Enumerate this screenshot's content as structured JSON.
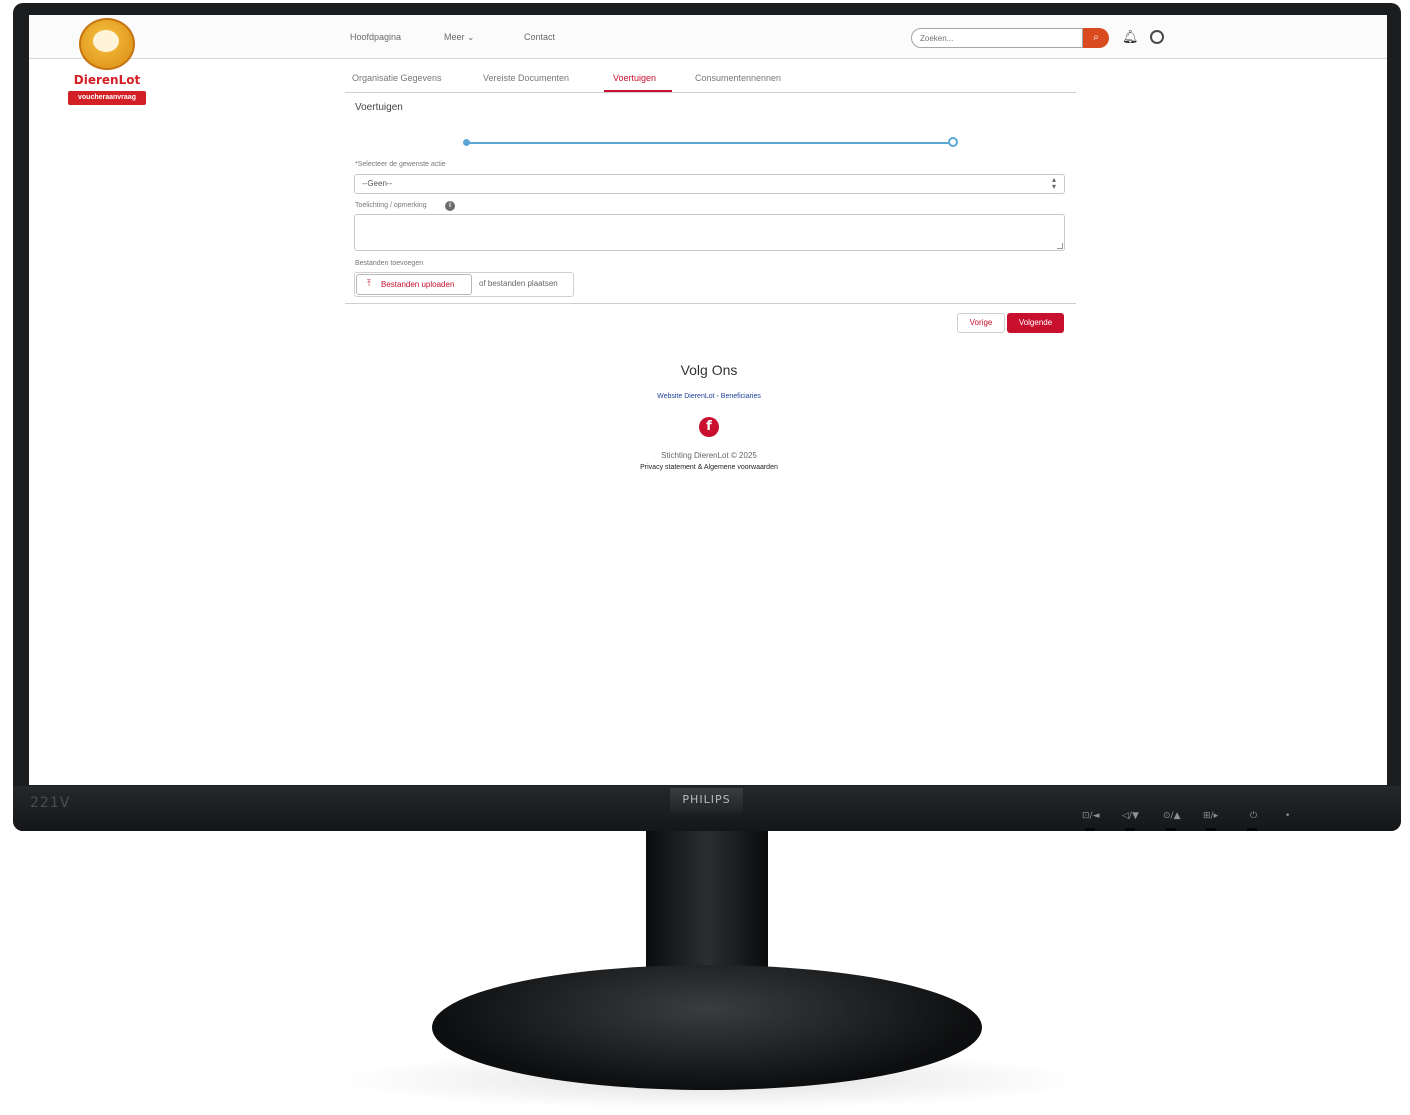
{
  "brand": {
    "logo_name": "DierenLot",
    "logo_tag": "voucheraanvraag",
    "monitor_model": "221V",
    "monitor_brand": "PHILIPS",
    "accent_color": "#c8102e"
  },
  "monitor_controls": [
    "⊡/◄",
    "◁/▼",
    "⊙/▲",
    "⊞/▸",
    "⏻",
    "•"
  ],
  "nav": {
    "items": [
      {
        "label": "Hoofdpagina"
      },
      {
        "label": "Meer ⌄"
      },
      {
        "label": "Contact"
      }
    ],
    "search_placeholder": "Zoeken...",
    "search_icon": "search-icon",
    "bell_icon": "bell-icon",
    "user_icon": "user-icon"
  },
  "tabs": [
    {
      "label": "Organisatie Gegevens"
    },
    {
      "label": "Vereiste Documenten"
    },
    {
      "label": "Voertuigen",
      "active": true
    },
    {
      "label": "Consumentennennen"
    }
  ],
  "form": {
    "section_title": "Voertuigen",
    "select_label": "*Selecteer de gewenste actie",
    "select_value": "--Geen--",
    "textarea_label": "Toelichting / opmerking",
    "upload_label": "Bestanden toevoegen",
    "upload_button": "Bestanden uploaden",
    "drop_text": "of bestanden plaatsen"
  },
  "actions": {
    "previous": "Vorige",
    "next": "Volgende"
  },
  "footer": {
    "follow_title": "Volg Ons",
    "links": "Website DierenLot - Beneficiaries",
    "facebook_icon": "facebook-icon",
    "copyright": "Stichting DierenLot © 2025",
    "legal": "Privacy statement & Algemene voorwaarden"
  }
}
